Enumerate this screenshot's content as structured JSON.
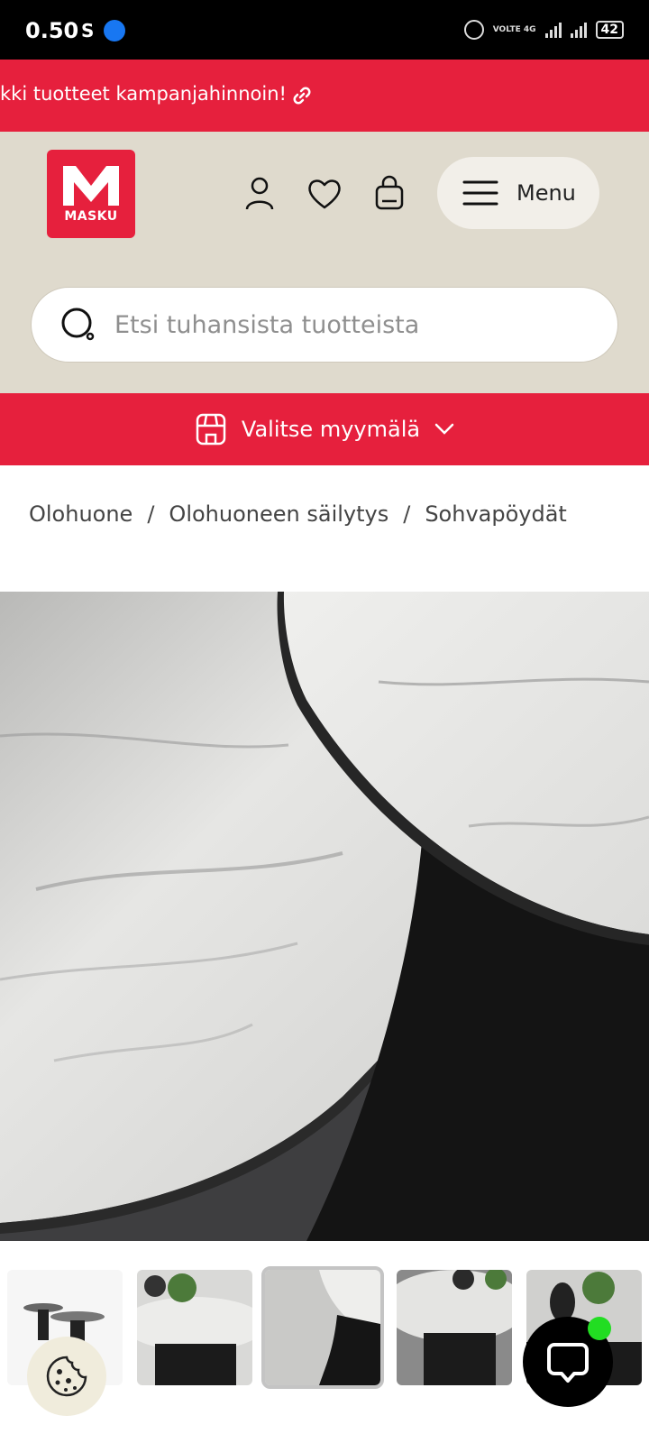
{
  "status_bar": {
    "time": "0.50",
    "carrier_letter": "S",
    "network": "VOLTE 4G",
    "battery": "42"
  },
  "promo": {
    "text": "kki tuotteet kampanjahinnoin!"
  },
  "header": {
    "logo_text": "MASKU",
    "menu_label": "Menu"
  },
  "search": {
    "placeholder": "Etsi tuhansista tuotteista"
  },
  "store": {
    "label": "Valitse myymälä"
  },
  "breadcrumb": {
    "items": [
      "Olohuone",
      "Olohuoneen säilytys",
      "Sohvapöydät"
    ],
    "separator": "/"
  },
  "gallery": {
    "thumbnail_count": 5,
    "selected_index": 2
  },
  "colors": {
    "brand_red": "#e6203d",
    "header_beige": "#dfdacd",
    "chat_online": "#22dd22"
  }
}
